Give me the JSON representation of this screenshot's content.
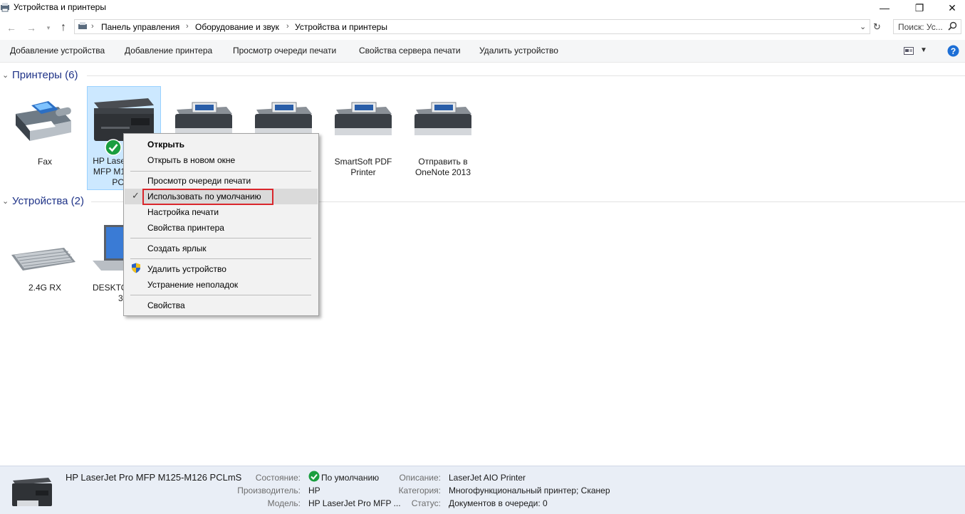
{
  "window": {
    "title": "Устройства и принтеры",
    "min": "—",
    "restore": "❐",
    "close": "✕"
  },
  "address": {
    "crumbs": [
      "Панель управления",
      "Оборудование и звук",
      "Устройства и принтеры"
    ],
    "search_placeholder": "Поиск: Ус..."
  },
  "toolbar": {
    "add_device": "Добавление устройства",
    "add_printer": "Добавление принтера",
    "view_queue": "Просмотр очереди печати",
    "server_props": "Свойства сервера печати",
    "remove_device": "Удалить устройство"
  },
  "groups": {
    "printers": {
      "title": "Принтеры (6)",
      "items": [
        {
          "label": "Fax"
        },
        {
          "label_line1": "HP Lase",
          "label_line2": "MFP M1",
          "label_line3": "PC"
        },
        {
          "label": ""
        },
        {
          "label": ""
        },
        {
          "label_line1": "SmartSoft PDF",
          "label_line2": "Printer"
        },
        {
          "label_line1": "Отправить в",
          "label_line2": "OneNote 2013"
        }
      ]
    },
    "devices": {
      "title": "Устройства (2)",
      "items": [
        {
          "label": "2.4G RX"
        },
        {
          "label_line1": "DESKTO",
          "label_line2": "3"
        }
      ]
    }
  },
  "context_menu": {
    "open": "Открыть",
    "open_new_window": "Открыть в новом окне",
    "view_queue": "Просмотр очереди печати",
    "set_default": "Использовать по умолчанию",
    "print_settings": "Настройка печати",
    "printer_props": "Свойства принтера",
    "create_shortcut": "Создать ярлык",
    "remove_device": "Удалить устройство",
    "troubleshoot": "Устранение неполадок",
    "properties": "Свойства"
  },
  "details": {
    "name": "HP LaserJet Pro MFP M125-M126 PCLmS",
    "state_label": "Состояние:",
    "state_value": "По умолчанию",
    "manufacturer_label": "Производитель:",
    "manufacturer_value": "HP",
    "model_label": "Модель:",
    "model_value": "HP LaserJet Pro MFP ...",
    "description_label": "Описание:",
    "description_value": "LaserJet AIO Printer",
    "category_label": "Категория:",
    "category_value": "Многофункциональный принтер; Сканер",
    "status_label": "Статус:",
    "status_value": "Документов в очереди: 0"
  },
  "colors": {
    "accent": "#1e3287",
    "selection": "#cce8ff",
    "highlight_box": "#d9262c",
    "status_green": "#1a9e3f",
    "help_blue": "#1d6fd6"
  }
}
